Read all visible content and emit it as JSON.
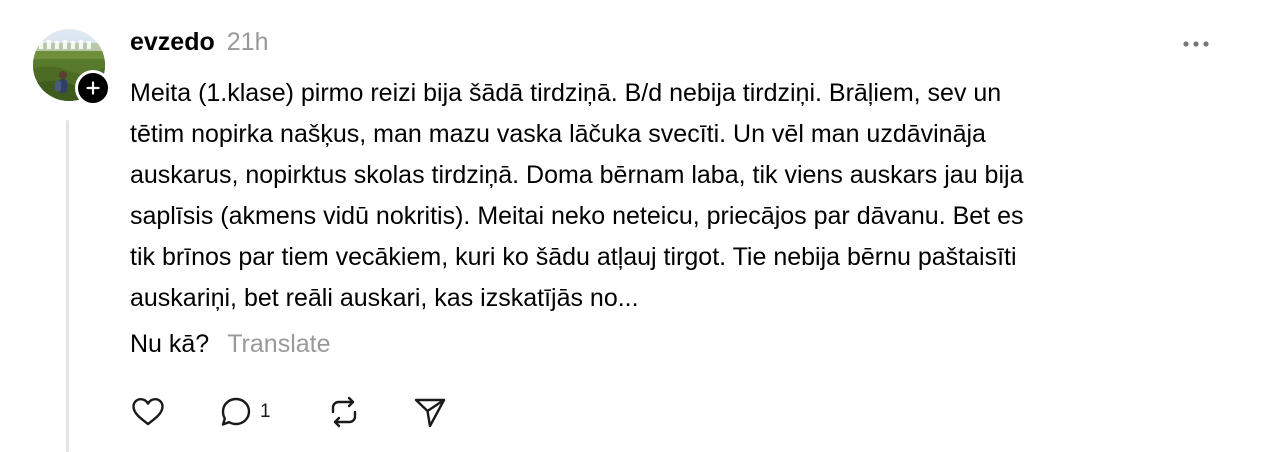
{
  "post": {
    "author": "evzedo",
    "timestamp": "21h",
    "text_lines": [
      "Meita (1.klase) pirmo reizi bija šādā tirdziņā. B/d nebija tirdziņi. Brāļiem, sev un",
      "tētim nopirka našķus, man mazu vaska lāčuka svecīti. Un vēl man uzdāvināja",
      "auskarus, nopirktus skolas tirdziņā. Doma bērnam laba, tik viens auskars jau bija",
      "saplīsis (akmens vidū nokritis). Meitai neko neteicu, priecājos par dāvanu. Bet es",
      "tik brīnos par tiem vecākiem, kuri ko šādu atļauj tirgot. Tie nebija bērnu paštaisīti",
      "auskariņi, bet reāli auskari, kas izskatījās no..."
    ],
    "closing_question": "Nu kā?",
    "translate_label": "Translate",
    "reply_count": "1"
  },
  "icons": {
    "follow": "plus-icon",
    "more": "more-horizontal-icon",
    "like": "heart-icon",
    "reply": "comment-bubble-icon",
    "repost": "repost-arrows-icon",
    "share": "send-paper-plane-icon"
  },
  "colors": {
    "text": "#000000",
    "muted": "#999999",
    "thread_line": "#e3e3e3"
  }
}
